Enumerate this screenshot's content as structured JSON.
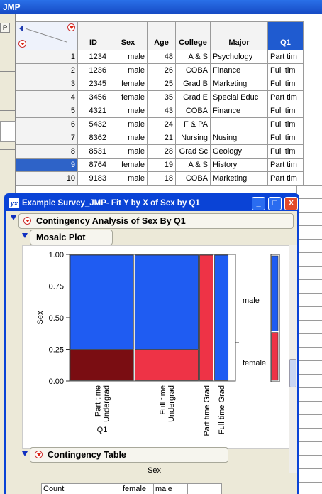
{
  "background_window": {
    "title": "JMP",
    "left_button_label": "P",
    "table": {
      "columns": [
        "ID",
        "Sex",
        "Age",
        "College",
        "Major",
        "Q1"
      ],
      "rows": [
        {
          "n": "1",
          "id": "1234",
          "sex": "male",
          "age": "48",
          "college": "A & S",
          "major": "Psychology",
          "q1": "Part tim"
        },
        {
          "n": "2",
          "id": "1236",
          "sex": "male",
          "age": "26",
          "college": "COBA",
          "major": "Finance",
          "q1": "Full tim"
        },
        {
          "n": "3",
          "id": "2345",
          "sex": "female",
          "age": "25",
          "college": "Grad B",
          "major": "Marketing",
          "q1": "Full tim"
        },
        {
          "n": "4",
          "id": "3456",
          "sex": "female",
          "age": "35",
          "college": "Grad E",
          "major": "Special Educ",
          "q1": "Part tim"
        },
        {
          "n": "5",
          "id": "4321",
          "sex": "male",
          "age": "43",
          "college": "COBA",
          "major": "Finance",
          "q1": "Full tim"
        },
        {
          "n": "6",
          "id": "5432",
          "sex": "male",
          "age": "24",
          "college": "F & PA",
          "major": "",
          "q1": "Full tim"
        },
        {
          "n": "7",
          "id": "8362",
          "sex": "male",
          "age": "21",
          "college": "Nursing",
          "major": "Nusing",
          "q1": "Full tim"
        },
        {
          "n": "8",
          "id": "8531",
          "sex": "male",
          "age": "28",
          "college": "Grad Sc",
          "major": "Geology",
          "q1": "Full tim"
        },
        {
          "n": "9",
          "id": "8764",
          "sex": "female",
          "age": "19",
          "college": "A & S",
          "major": "History",
          "q1": "Part tim"
        },
        {
          "n": "10",
          "id": "9183",
          "sex": "male",
          "age": "18",
          "college": "COBA",
          "major": "Marketing",
          "q1": "Part tim"
        }
      ],
      "selected_row": 9
    }
  },
  "report_window": {
    "title": "Example Survey_JMP- Fit Y by X of Sex by Q1",
    "controls": {
      "minimize": "_",
      "maximize": "□",
      "close": "X"
    },
    "analysis_header": "Contingency Analysis of Sex By Q1",
    "mosaic_header": "Mosaic Plot",
    "table_header": "Contingency Table",
    "table_col_group": "Sex",
    "table_header_row": [
      "Count",
      "female",
      "male",
      ""
    ]
  },
  "chart_data": {
    "type": "mosaic",
    "xlabel": "Q1",
    "ylabel": "Sex",
    "y_ticks": [
      "1.00",
      "0.75",
      "0.50",
      "0.25",
      "0.00"
    ],
    "categories": [
      "Part time Undergrad",
      "Full time Undergrad",
      "Part time Grad",
      "Full time Grad"
    ],
    "category_labels": [
      [
        "Part time",
        "Undergrad"
      ],
      [
        "Full time",
        "Undergrad"
      ],
      [
        "Part time Grad"
      ],
      [
        "Full time Grad"
      ]
    ],
    "widths": [
      0.39,
      0.39,
      0.09,
      0.09
    ],
    "series": [
      {
        "name": "female",
        "values": [
          0.25,
          0.25,
          1.0,
          0.0
        ]
      },
      {
        "name": "male",
        "values": [
          0.75,
          0.75,
          0.0,
          1.0
        ]
      }
    ],
    "legend": [
      "male",
      "female"
    ],
    "marginal_male_share": 0.6,
    "colors": {
      "male": "#1f5cf2",
      "female": "#ee3346",
      "female_dark": "#7a0d12"
    }
  }
}
